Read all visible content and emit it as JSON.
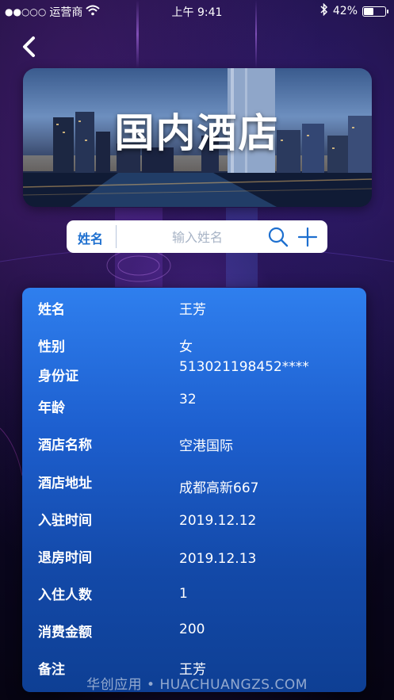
{
  "status_bar": {
    "signal": "●●○○○",
    "carrier": "运营商",
    "time": "上午 9:41",
    "battery_percent": "42%",
    "battery_level": 0.42
  },
  "banner": {
    "title": "国内酒店"
  },
  "search": {
    "label": "姓名",
    "placeholder": "输入姓名",
    "value": ""
  },
  "details": {
    "rows": [
      {
        "label": "姓名",
        "value": "王芳"
      },
      {
        "label": "性别",
        "value": "女"
      },
      {
        "label": "身份证",
        "value": "513021198452****"
      },
      {
        "label": "年龄",
        "value": "32"
      },
      {
        "label": "酒店名称",
        "value": "空港国际"
      },
      {
        "label": "酒店地址",
        "value": "成都高新667"
      },
      {
        "label": "入驻时间",
        "value": "2019.12.12"
      },
      {
        "label": "退房时间",
        "value": "2019.12.13"
      },
      {
        "label": "入住人数",
        "value": "1"
      },
      {
        "label": "消费金额",
        "value": "200"
      },
      {
        "label": "备注",
        "value": "王芳"
      }
    ]
  },
  "watermark": "华创应用 • HUACHUANGZS.COM",
  "icons": {
    "back": "chevron-left-icon",
    "search": "search-icon",
    "add": "plus-icon",
    "wifi": "wifi-icon",
    "bluetooth": "bluetooth-icon",
    "battery": "battery-icon"
  },
  "colors": {
    "accent": "#1d6fcf",
    "card_top": "#2f7fee",
    "card_bottom": "#0e3f94"
  }
}
